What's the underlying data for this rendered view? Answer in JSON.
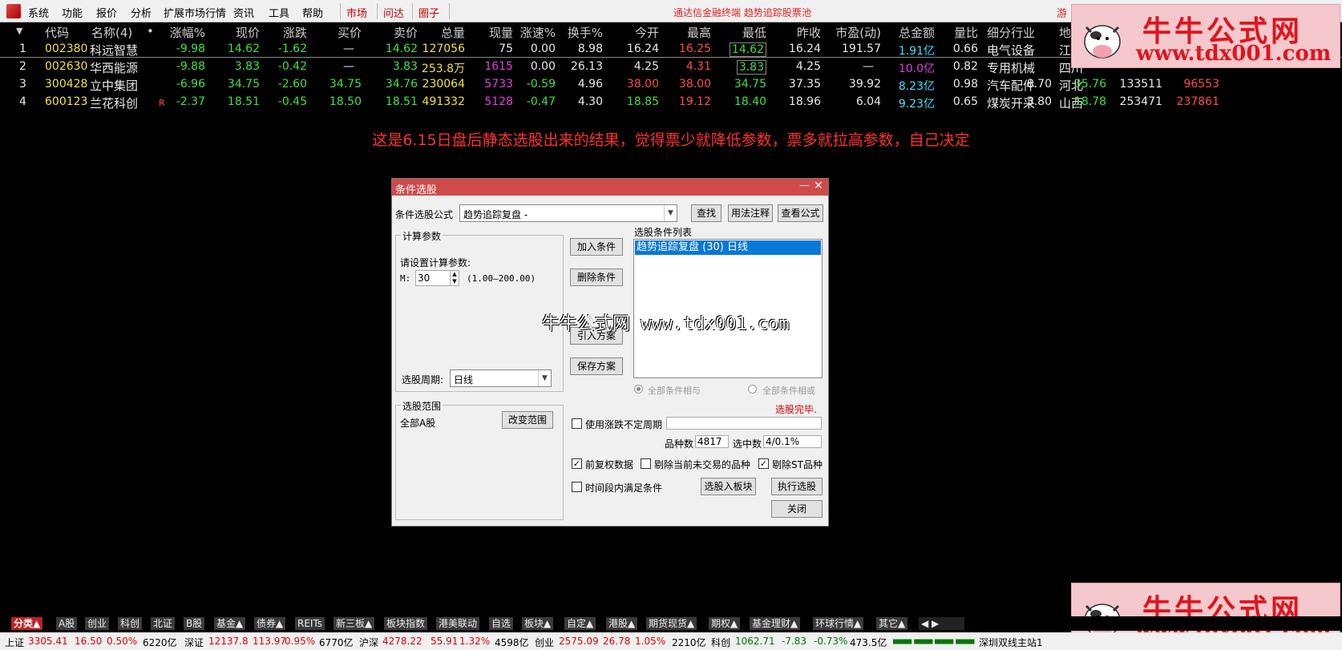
{
  "menu": {
    "items": [
      "系统",
      "功能",
      "报价",
      "分析",
      "扩展市场行情",
      "资讯",
      "工具",
      "帮助"
    ],
    "tabs": [
      "市场",
      "问达",
      "圈子"
    ],
    "center_title": "通达信金融终端    趋势追踪股票池",
    "ext": "游"
  },
  "table": {
    "headers": [
      "代码",
      "名称(4)",
      "•",
      "涨幅%",
      "现价",
      "涨跌",
      "买价",
      "卖价",
      "总量",
      "现量",
      "涨速%",
      "换手%",
      "今开",
      "最高",
      "最低",
      "昨收",
      "市盈(动)",
      "总金额",
      "量比",
      "细分行业",
      "地区"
    ],
    "rows": [
      {
        "idx": "1",
        "code": "002380",
        "name": "科远智慧",
        "flag": "",
        "change_pct": "-9.98",
        "price": "14.62",
        "change": "-1.62",
        "bid": "—",
        "ask": "14.62",
        "volume": "127056",
        "cur_vol": "75",
        "speed": "0.00",
        "turnover": "8.98",
        "open": "16.24",
        "high": "16.25",
        "low": "14.62",
        "prev_close": "16.24",
        "pe": "191.57",
        "amount": "1.91亿",
        "vol_ratio": "0.66",
        "industry": "电气设备",
        "region": "江"
      },
      {
        "idx": "2",
        "code": "002630",
        "name": "华西能源",
        "flag": "",
        "change_pct": "-9.88",
        "price": "3.83",
        "change": "-0.42",
        "bid": "—",
        "ask": "3.83",
        "volume": "253.8万",
        "cur_vol": "1615",
        "speed": "0.00",
        "turnover": "26.13",
        "open": "4.25",
        "high": "4.31",
        "low": "3.83",
        "prev_close": "4.25",
        "pe": "—",
        "amount": "10.0亿",
        "vol_ratio": "0.82",
        "industry": "专用机械",
        "region": "四川"
      },
      {
        "idx": "3",
        "code": "300428",
        "name": "立中集团",
        "flag": "",
        "change_pct": "-6.96",
        "price": "34.75",
        "change": "-2.60",
        "bid": "34.75",
        "ask": "34.76",
        "volume": "230064",
        "cur_vol": "5733",
        "speed": "-0.59",
        "turnover": "4.96",
        "open": "38.00",
        "high": "38.00",
        "low": "34.75",
        "prev_close": "37.35",
        "pe": "39.92",
        "amount": "8.23亿",
        "vol_ratio": "0.98",
        "industry": "汽车配件",
        "region": "河北",
        "x1": "8.70",
        "x2": "35.76",
        "x3": "133511",
        "x4": "96553"
      },
      {
        "idx": "4",
        "code": "600123",
        "name": "兰花科创",
        "flag": "R",
        "change_pct": "-2.37",
        "price": "18.51",
        "change": "-0.45",
        "bid": "18.50",
        "ask": "18.51",
        "volume": "491332",
        "cur_vol": "5128",
        "speed": "-0.47",
        "turnover": "4.30",
        "open": "18.85",
        "high": "19.12",
        "low": "18.40",
        "prev_close": "18.96",
        "pe": "6.04",
        "amount": "9.23亿",
        "vol_ratio": "0.65",
        "industry": "煤炭开采",
        "region": "山西",
        "x1": "3.80",
        "x2": "18.78",
        "x3": "253471",
        "x4": "237861"
      }
    ]
  },
  "notice": "这是6.15日盘后静态选股出来的结果，觉得票少就降低参数，票多就拉高参数，自己决定",
  "dialog": {
    "title": "条件选股",
    "formula_label": "条件选股公式",
    "formula_value": "趋势追踪复盘 -",
    "find_button": "查找",
    "usage_button": "用法注释",
    "view_button": "查看公式",
    "calc_group": "计算参数",
    "calc_prompt": "请设置计算参数:",
    "param_name": "M:",
    "param_value": "30",
    "param_range": "(1.00—200.00)",
    "period_label": "选股周期:",
    "period_value": "日线",
    "add_button": "加入条件",
    "delete_button": "删除条件",
    "import_button": "引入方案",
    "save_button": "保存方案",
    "list_label": "选股条件列表",
    "list_items": [
      "趋势追踪复盘 (30) 日线"
    ],
    "radio_and": "全部条件相与",
    "radio_or": "全部条件相或",
    "status": "选股完毕.",
    "scope_group": "选股范围",
    "scope_value": "全部A股",
    "change_scope_button": "改变范围",
    "uncertain_period": "使用涨跌不定周期",
    "count_label": "品种数",
    "count_value": "4817",
    "selected_label": "选中数",
    "selected_value": "4/0.1%",
    "pre_adjust": "前复权数据",
    "remove_untraded": "剔除当前未交易的品种",
    "remove_st": "剔除ST品种",
    "time_range": "时间段内满足条件",
    "to_block_button": "选股入板块",
    "execute_button": "执行选股",
    "close_button": "关闭",
    "checks": {
      "pre_adjust": true,
      "remove_untraded": false,
      "remove_st": true,
      "time_range": false,
      "uncertain_period": false
    }
  },
  "watermark": "牛牛公式网 www.tdx001.com",
  "brand": {
    "name": "牛牛公式网",
    "url": "www.tdx001.com"
  },
  "bottom_tabs": [
    "分类▲",
    "A股",
    "创业",
    "科创",
    "北证",
    "B股",
    "基金▲",
    "债券▲",
    "REITs",
    "新三板▲",
    "板块指数",
    "港美联动",
    "自选",
    "板块▲",
    "自定▲",
    "港股▲",
    "期货现货▲",
    "期权▲",
    "基金理财▲",
    "环球行情▲",
    "其它▲"
  ],
  "status": {
    "sh_label": "上证",
    "sh_val": "3305.41",
    "sh_chg": "16.50",
    "sh_pct": "0.50%",
    "sh_amt": "6220亿",
    "sz_label": "深证",
    "sz_val": "12137.8",
    "sz_chg": "113.97",
    "sz_pct": "0.95%",
    "sz_amt": "6770亿",
    "hs_label": "沪深",
    "hs_val": "4278.22",
    "hs_chg": "55.91",
    "hs_pct": "1.32%",
    "hs_amt": "4598亿",
    "cy_label": "创业",
    "cy_val": "2575.09",
    "cy_chg": "26.78",
    "cy_pct": "1.05%",
    "cy_amt": "2210亿",
    "kc_label": "科创",
    "kc_val": "1062.71",
    "kc_chg": "-7.83",
    "kc_pct": "-0.73%",
    "kc_amt": "473.5亿",
    "server": "深圳双线主站1"
  }
}
